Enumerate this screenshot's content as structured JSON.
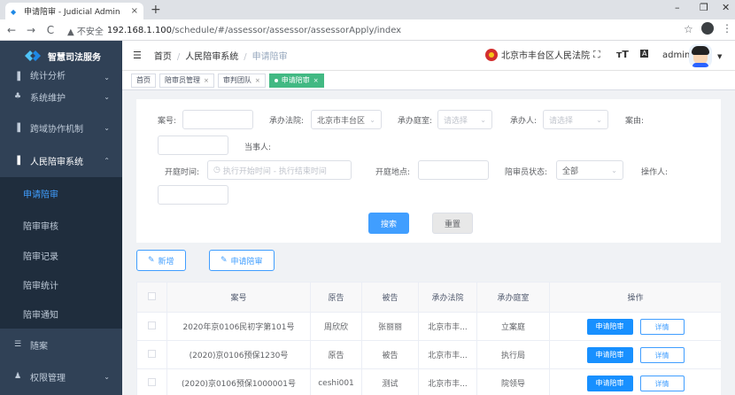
{
  "browser": {
    "tab_title": "申请陪审 - Judicial Admin",
    "new_tab": "+",
    "url_warning": "▲ 不安全",
    "url_host": "192.168.1.100",
    "url_path": "/schedule/#/assessor/assessor/assessorApply/index"
  },
  "sidebar": {
    "brand": "智慧司法服务",
    "items": [
      {
        "label": "统计分析"
      },
      {
        "label": "系统维护"
      },
      {
        "label": "跨域协作机制"
      },
      {
        "label": "人民陪审系统"
      }
    ],
    "sub_items": [
      {
        "label": "申请陪审"
      },
      {
        "label": "陪审审核"
      },
      {
        "label": "陪审记录"
      },
      {
        "label": "陪审统计"
      },
      {
        "label": "陪审通知"
      }
    ],
    "bottom_items": [
      {
        "label": "随案"
      },
      {
        "label": "权限管理"
      }
    ]
  },
  "header": {
    "breadcrumb": [
      "首页",
      "人民陪审系统",
      "申请陪审"
    ],
    "court": "北京市丰台区人民法院",
    "username": "admin"
  },
  "tags": [
    {
      "label": "首页"
    },
    {
      "label": "陪审员管理"
    },
    {
      "label": "审判团队"
    },
    {
      "label": "申请陪审"
    }
  ],
  "search": {
    "case_no_label": "案号:",
    "court_label": "承办法院:",
    "court_value": "北京市丰台区",
    "tribunal_label": "承办庭室:",
    "tribunal_placeholder": "请选择",
    "handler_label": "承办人:",
    "handler_placeholder": "请选择",
    "cause_label": "案由:",
    "party_label": "当事人:",
    "time_label": "开庭时间:",
    "time_placeholder": "执行开始时间 - 执行结束时间",
    "place_label": "开庭地点:",
    "status_label": "陪审员状态:",
    "status_value": "全部",
    "operator_label": "操作人:",
    "search_button": "搜索",
    "reset_button": "重置"
  },
  "toolbar": {
    "add_label": "新增",
    "apply_label": "申请陪审"
  },
  "table": {
    "headers": [
      "案号",
      "原告",
      "被告",
      "承办法院",
      "承办庭室",
      "操作"
    ],
    "apply_btn": "申请陪审",
    "detail_btn": "详情",
    "rows": [
      {
        "case": "2020年京0106民初字第101号",
        "plaintiff": "周欣欣",
        "defendant": "张丽丽",
        "court": "北京市丰...",
        "tribunal": "立案庭"
      },
      {
        "case": "(2020)京0106预保1230号",
        "plaintiff": "原告",
        "defendant": "被告",
        "court": "北京市丰...",
        "tribunal": "执行局"
      },
      {
        "case": "(2020)京0106预保1000001号",
        "plaintiff": "ceshi001",
        "defendant": "测试",
        "court": "北京市丰...",
        "tribunal": "院领导"
      }
    ]
  }
}
